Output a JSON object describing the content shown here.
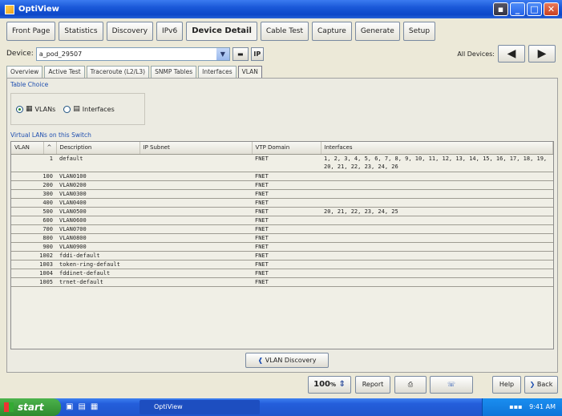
{
  "window": {
    "title": "OptiView"
  },
  "nav": {
    "tabs": [
      "Front Page",
      "Statistics",
      "Discovery",
      "IPv6",
      "Device Detail",
      "Cable Test",
      "Capture",
      "Generate",
      "Setup"
    ],
    "active_index": 4
  },
  "device": {
    "label": "Device:",
    "value": "a_pod_29507",
    "btn1": "",
    "btn2": "IP",
    "all_label": "All Devices:"
  },
  "subtabs": {
    "items": [
      "Overview",
      "Active Test",
      "Traceroute (L2/L3)",
      "SNMP Tables",
      "Interfaces",
      "VLAN"
    ],
    "active_index": 5
  },
  "table_choice": {
    "title": "Table Choice",
    "vlans_label": "VLANs",
    "interfaces_label": "Interfaces",
    "selected": "VLANs"
  },
  "vlans": {
    "section_title": "Virtual LANs on this Switch",
    "columns": [
      "VLAN",
      "^",
      "Description",
      "IP Subnet",
      "VTP Domain",
      "Interfaces"
    ],
    "rows": [
      {
        "vlan": "1",
        "description": "default",
        "subnet": "",
        "domain": "FNET",
        "interfaces": "1, 2, 3, 4, 5, 6, 7, 8, 9, 10, 11, 12, 13, 14, 15, 16, 17, 18, 19, 20, 21, 22, 23, 24, 26"
      },
      {
        "vlan": "100",
        "description": "VLAN0100",
        "subnet": "",
        "domain": "FNET",
        "interfaces": ""
      },
      {
        "vlan": "200",
        "description": "VLAN0200",
        "subnet": "",
        "domain": "FNET",
        "interfaces": ""
      },
      {
        "vlan": "300",
        "description": "VLAN0300",
        "subnet": "",
        "domain": "FNET",
        "interfaces": ""
      },
      {
        "vlan": "400",
        "description": "VLAN0400",
        "subnet": "",
        "domain": "FNET",
        "interfaces": ""
      },
      {
        "vlan": "500",
        "description": "VLAN0500",
        "subnet": "",
        "domain": "FNET",
        "interfaces": "20, 21, 22, 23, 24, 25"
      },
      {
        "vlan": "600",
        "description": "VLAN0600",
        "subnet": "",
        "domain": "FNET",
        "interfaces": ""
      },
      {
        "vlan": "700",
        "description": "VLAN0700",
        "subnet": "",
        "domain": "FNET",
        "interfaces": ""
      },
      {
        "vlan": "800",
        "description": "VLAN0800",
        "subnet": "",
        "domain": "FNET",
        "interfaces": ""
      },
      {
        "vlan": "900",
        "description": "VLAN0900",
        "subnet": "",
        "domain": "FNET",
        "interfaces": ""
      },
      {
        "vlan": "1002",
        "description": "fddi-default",
        "subnet": "",
        "domain": "FNET",
        "interfaces": ""
      },
      {
        "vlan": "1003",
        "description": "token-ring-default",
        "subnet": "",
        "domain": "FNET",
        "interfaces": ""
      },
      {
        "vlan": "1004",
        "description": "fddinet-default",
        "subnet": "",
        "domain": "FNET",
        "interfaces": ""
      },
      {
        "vlan": "1005",
        "description": "trnet-default",
        "subnet": "",
        "domain": "FNET",
        "interfaces": ""
      }
    ],
    "discovery_button": "VLAN Discovery"
  },
  "bottom": {
    "zoom": "100",
    "report": "Report",
    "help": "Help",
    "back": "Back"
  },
  "taskbar": {
    "start": "start",
    "item": "OptiView",
    "clock": "9:41 AM"
  }
}
